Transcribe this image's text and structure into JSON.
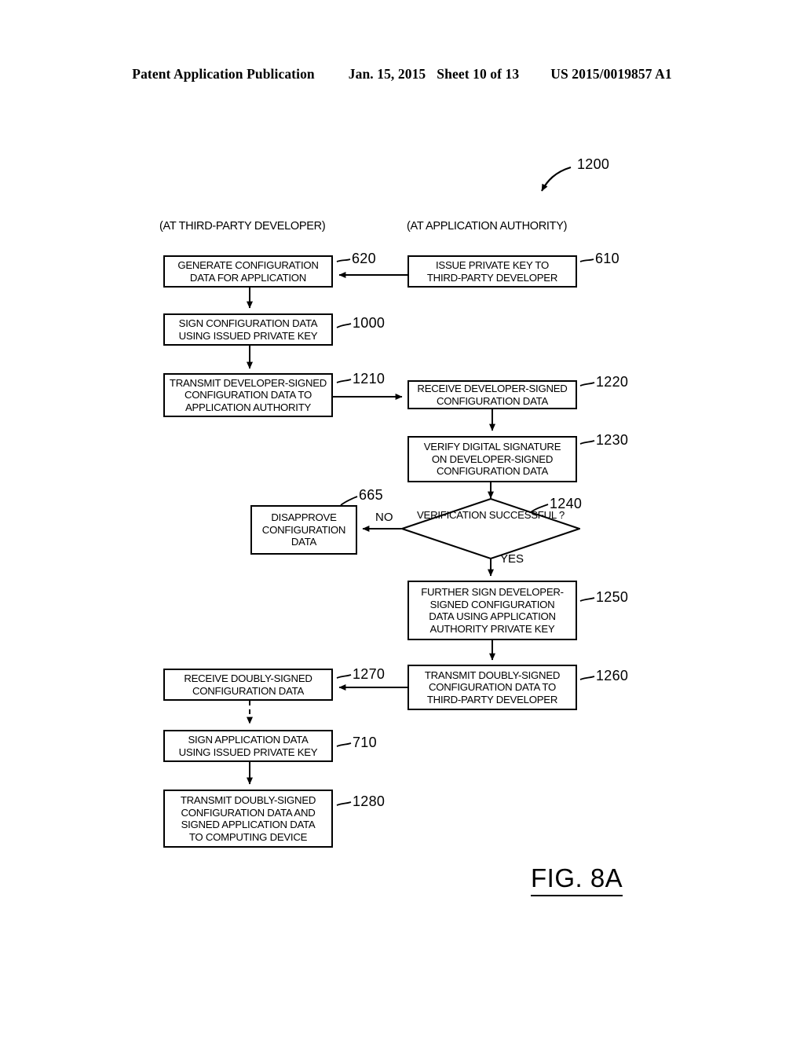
{
  "header": {
    "publication": "Patent Application Publication",
    "date": "Jan. 15, 2015",
    "sheet": "Sheet 10 of 13",
    "number": "US 2015/0019857 A1"
  },
  "figure": {
    "title": "FIG. 8A",
    "diagram_ref": "1200",
    "columns": {
      "left_caption": "(AT THIRD-PARTY DEVELOPER)",
      "right_caption": "(AT APPLICATION AUTHORITY)"
    },
    "branch_labels": {
      "no": "NO",
      "yes": "YES"
    },
    "nodes": [
      {
        "id": "620",
        "ref": "620",
        "shape": "process",
        "lines": [
          "GENERATE CONFIGURATION",
          "DATA FOR APPLICATION"
        ]
      },
      {
        "id": "610",
        "ref": "610",
        "shape": "process",
        "lines": [
          "ISSUE PRIVATE KEY TO",
          "THIRD-PARTY DEVELOPER"
        ]
      },
      {
        "id": "1000",
        "ref": "1000",
        "shape": "process",
        "lines": [
          "SIGN CONFIGURATION DATA",
          "USING ISSUED PRIVATE KEY"
        ]
      },
      {
        "id": "1210",
        "ref": "1210",
        "shape": "process",
        "lines": [
          "TRANSMIT DEVELOPER-SIGNED",
          "CONFIGURATION DATA TO",
          "APPLICATION AUTHORITY"
        ]
      },
      {
        "id": "1220",
        "ref": "1220",
        "shape": "process",
        "lines": [
          "RECEIVE DEVELOPER-SIGNED",
          "CONFIGURATION DATA"
        ]
      },
      {
        "id": "1230",
        "ref": "1230",
        "shape": "process",
        "lines": [
          "VERIFY DIGITAL SIGNATURE",
          "ON DEVELOPER-SIGNED",
          "CONFIGURATION DATA"
        ]
      },
      {
        "id": "1240",
        "ref": "1240",
        "shape": "decision",
        "lines": [
          "VERIFICATION",
          "SUCCESSFUL",
          "?"
        ]
      },
      {
        "id": "665",
        "ref": "665",
        "shape": "process",
        "lines": [
          "DISAPPROVE",
          "CONFIGURATION",
          "DATA"
        ]
      },
      {
        "id": "1250",
        "ref": "1250",
        "shape": "process",
        "lines": [
          "FURTHER SIGN DEVELOPER-",
          "SIGNED CONFIGURATION",
          "DATA USING APPLICATION",
          "AUTHORITY PRIVATE KEY"
        ]
      },
      {
        "id": "1260",
        "ref": "1260",
        "shape": "process",
        "lines": [
          "TRANSMIT DOUBLY-SIGNED",
          "CONFIGURATION DATA TO",
          "THIRD-PARTY DEVELOPER"
        ]
      },
      {
        "id": "1270",
        "ref": "1270",
        "shape": "process",
        "lines": [
          "RECEIVE DOUBLY-SIGNED",
          "CONFIGURATION DATA"
        ]
      },
      {
        "id": "710",
        "ref": "710",
        "shape": "process",
        "lines": [
          "SIGN APPLICATION DATA",
          "USING ISSUED PRIVATE KEY"
        ]
      },
      {
        "id": "1280",
        "ref": "1280",
        "shape": "process",
        "lines": [
          "TRANSMIT DOUBLY-SIGNED",
          "CONFIGURATION DATA AND",
          "SIGNED APPLICATION DATA",
          "TO COMPUTING DEVICE"
        ]
      }
    ]
  }
}
